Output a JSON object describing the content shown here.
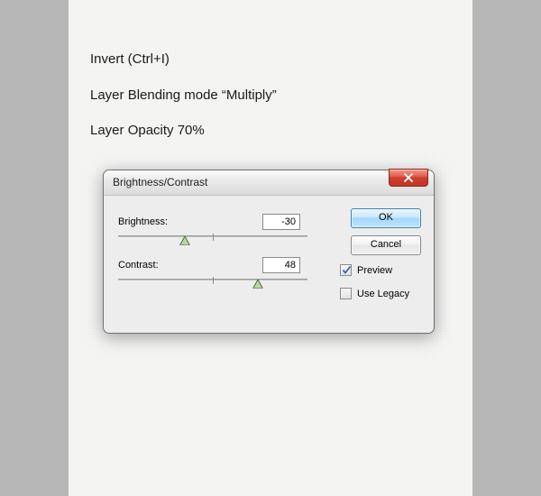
{
  "instructions": {
    "line1": "Invert (Ctrl+I)",
    "line2": "Layer Blending mode “Multiply”",
    "line3": "Layer Opacity 70%"
  },
  "dialog": {
    "title": "Brightness/Contrast",
    "brightness": {
      "label": "Brightness:",
      "value": "-30",
      "thumb_percent": 35
    },
    "contrast": {
      "label": "Contrast:",
      "value": "48",
      "thumb_percent": 74
    },
    "buttons": {
      "ok": "OK",
      "cancel": "Cancel"
    },
    "preview": {
      "label": "Preview",
      "checked": true
    },
    "legacy": {
      "label": "Use Legacy",
      "checked": false
    }
  }
}
